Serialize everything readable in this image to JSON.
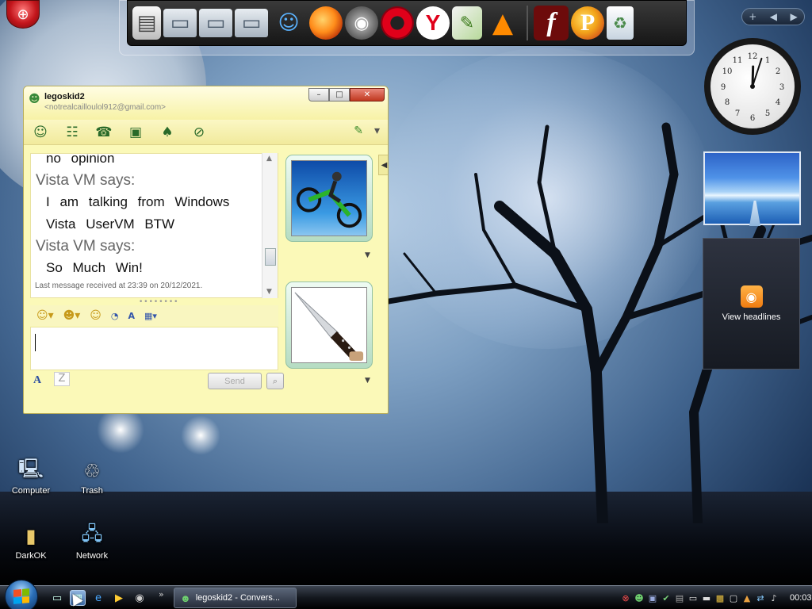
{
  "dock": {
    "icons": [
      "notes-icon",
      "folder-icon",
      "folder-icon",
      "folder-icon",
      "users-icon",
      "firefox-icon",
      "raccoon-icon",
      "opera-icon",
      "yandex-icon",
      "document-icon",
      "vlc-icon",
      "flash-icon",
      "p-app-icon",
      "recycle-bin-icon"
    ],
    "yandex_label": "Y",
    "flash_label": "f",
    "p_label": "P"
  },
  "sidebar": {
    "controls": {
      "add": "+",
      "prev": "◀",
      "next": "▶"
    },
    "feed_text": "View headlines"
  },
  "clock": {
    "hour": 12,
    "minute": 3
  },
  "conversation": {
    "user_name": "legoskid2",
    "user_email": "<notrealcailloulol912@gmail.com>",
    "title_buttons": {
      "minimize": "–",
      "maximize": "□",
      "close": "✕"
    },
    "messages": [
      {
        "text": "no opinion"
      },
      {
        "speaker": "Vista VM says:",
        "text": "I am talking from Windows Vista UserVM BTW"
      },
      {
        "speaker": "Vista VM says:",
        "text": "So Much Win!"
      }
    ],
    "last_received": "Last message received at 23:39 on 20/12/2021.",
    "font_button": "A",
    "send_label": "Send",
    "grip": "••••••••"
  },
  "desktop_icons": [
    {
      "label": "Computer"
    },
    {
      "label": "Trash"
    },
    {
      "label": "DarkOK"
    },
    {
      "label": "Network"
    }
  ],
  "taskbar": {
    "task_label": "legoskid2 - Convers...",
    "chevron": "»",
    "time": "00:03"
  },
  "colors": {
    "window_bg": "#fbf9b8",
    "taskbar": "#14181f",
    "accent_red": "#c4161c"
  }
}
